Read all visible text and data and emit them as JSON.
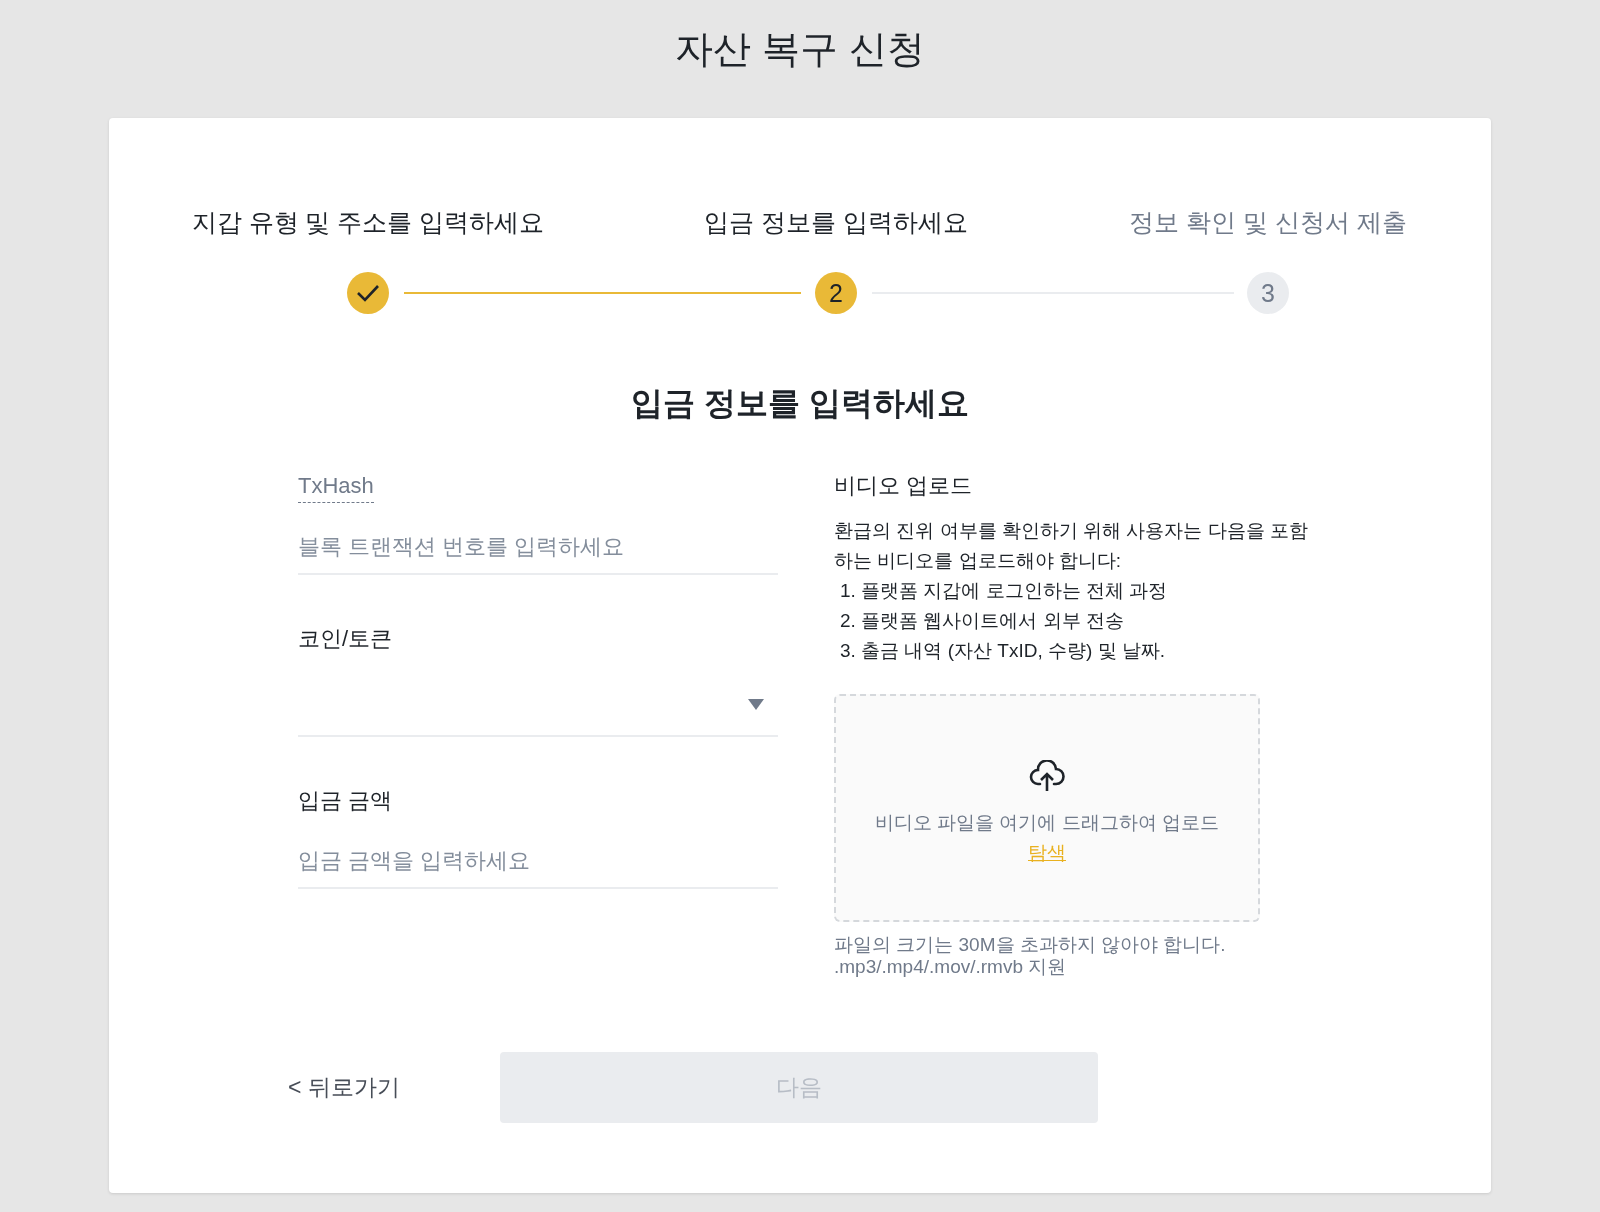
{
  "page": {
    "title": "자산 복구 신청"
  },
  "steps": [
    {
      "label": "지갑 유형 및 주소를 입력하세요",
      "kind": "done"
    },
    {
      "label": "입금 정보를 입력하세요",
      "kind": "current",
      "number": "2"
    },
    {
      "label": "정보 확인 및 신청서 제출",
      "kind": "upcoming",
      "number": "3"
    }
  ],
  "section_title": "입금 정보를 입력하세요",
  "form": {
    "fields": [
      {
        "kind": "text",
        "label": "TxHash",
        "label_hint": true,
        "placeholder": "블록 트랜잭션 번호를 입력하세요"
      },
      {
        "kind": "select",
        "label": "코인/토큰",
        "label_hint": false
      },
      {
        "kind": "text",
        "label": "입금 금액",
        "label_hint": false,
        "placeholder": "입금 금액을 입력하세요"
      }
    ]
  },
  "video_upload": {
    "title": "비디오 업로드",
    "description": "환급의 진위 여부를 확인하기 위해 사용자는 다음을 포함하는 비디오를 업로드해야 합니다:",
    "requirements": [
      "1. 플랫폼 지갑에 로그인하는 전체 과정",
      "2. 플랫폼 웹사이트에서 외부 전송",
      "3. 출금 내역 (자산 TxID, 수량) 및 날짜."
    ],
    "dropzone_text": "비디오 파일을 여기에 드래그하여 업로드",
    "browse_link": "탐색",
    "note": "파일의 크기는 30M을 초과하지 않아야 합니다. .mp3/.mp4/.mov/.rmvb 지원"
  },
  "footer": {
    "back_link": "< 뒤로가기",
    "next_button": {
      "label": "다음",
      "disabled": true
    }
  }
}
